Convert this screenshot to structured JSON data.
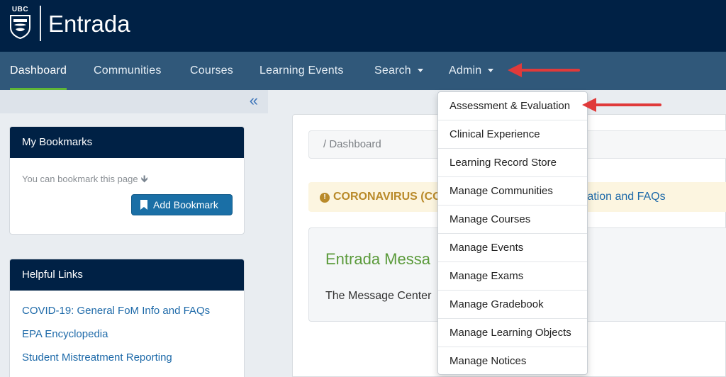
{
  "header": {
    "logo_text": "UBC",
    "brand": "Entrada"
  },
  "nav": {
    "items": [
      {
        "label": "Dashboard",
        "active": true
      },
      {
        "label": "Communities"
      },
      {
        "label": "Courses"
      },
      {
        "label": "Learning Events"
      },
      {
        "label": "Search",
        "dropdown": true
      },
      {
        "label": "Admin",
        "dropdown": true,
        "open": true
      }
    ]
  },
  "sidebar": {
    "collapse_icon": "«",
    "bookmarks": {
      "title": "My Bookmarks",
      "hint": "You can bookmark this page",
      "add_label": "Add Bookmark"
    },
    "helpful_links": {
      "title": "Helpful Links",
      "links": [
        "COVID-19: General FoM Info and FAQs",
        "EPA Encyclopedia",
        "Student Mistreatment Reporting"
      ]
    }
  },
  "main": {
    "breadcrumb": "/  Dashboard",
    "notice_title": "CORONAVIRUS (CO",
    "notice_link": "mation and FAQs",
    "message_title": "Entrada Messa",
    "message_body": "The Message Center"
  },
  "admin_menu": {
    "items": [
      "Assessment & Evaluation",
      "Clinical Experience",
      "Learning Record Store",
      "Manage Communities",
      "Manage Courses",
      "Manage Events",
      "Manage Exams",
      "Manage Gradebook",
      "Manage Learning Objects",
      "Manage Notices"
    ]
  },
  "colors": {
    "header": "#002145",
    "navbar": "#30587a",
    "active_underline": "#5fb636",
    "annotation_arrow": "#e03a3a",
    "link": "#1e6aa9"
  }
}
